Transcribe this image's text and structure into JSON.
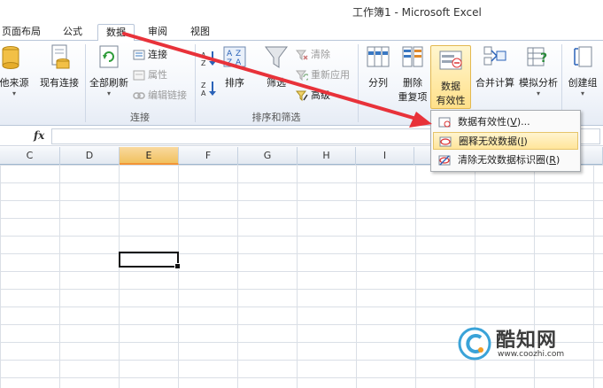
{
  "window": {
    "title": "工作簿1 - Microsoft Excel"
  },
  "tabs": [
    {
      "label": "页面布局"
    },
    {
      "label": "公式"
    },
    {
      "label": "数据"
    },
    {
      "label": "审阅"
    },
    {
      "label": "视图"
    }
  ],
  "ribbon": {
    "get_external": {
      "from_other": "他来源",
      "existing_connections": "现有连接"
    },
    "connections": {
      "refresh_all": "全部刷新",
      "connections": "连接",
      "properties": "属性",
      "edit_links": "编辑链接",
      "group_label": "连接"
    },
    "sort_filter": {
      "sort": "排序",
      "filter": "筛选",
      "clear": "清除",
      "reapply": "重新应用",
      "advanced": "高级",
      "group_label": "排序和筛选"
    },
    "data_tools": {
      "text_to_columns": "分列",
      "remove_duplicates": [
        "删除",
        "重复项"
      ],
      "data_validation": [
        "数据",
        "有效性"
      ],
      "consolidate": "合并计算",
      "what_if": "模拟分析"
    },
    "outline": {
      "group": "创建组"
    }
  },
  "dropdown": {
    "items": [
      {
        "label": "数据有效性(",
        "key": "V",
        "suffix": ")..."
      },
      {
        "label": "圈释无效数据(",
        "key": "I",
        "suffix": ")"
      },
      {
        "label": "清除无效数据标识圈(",
        "key": "R",
        "suffix": ")"
      }
    ]
  },
  "formula_bar": {
    "fx": "fx",
    "value": ""
  },
  "columns": [
    "C",
    "D",
    "E",
    "F",
    "G",
    "H",
    "I"
  ],
  "selected_column": "E",
  "watermark": {
    "name": "酷知网",
    "url": "www.coozhi.com"
  },
  "colors": {
    "accent_arrow": "#e8323a",
    "highlight": "#ffe08a",
    "selection_header": "#f1c15f"
  }
}
